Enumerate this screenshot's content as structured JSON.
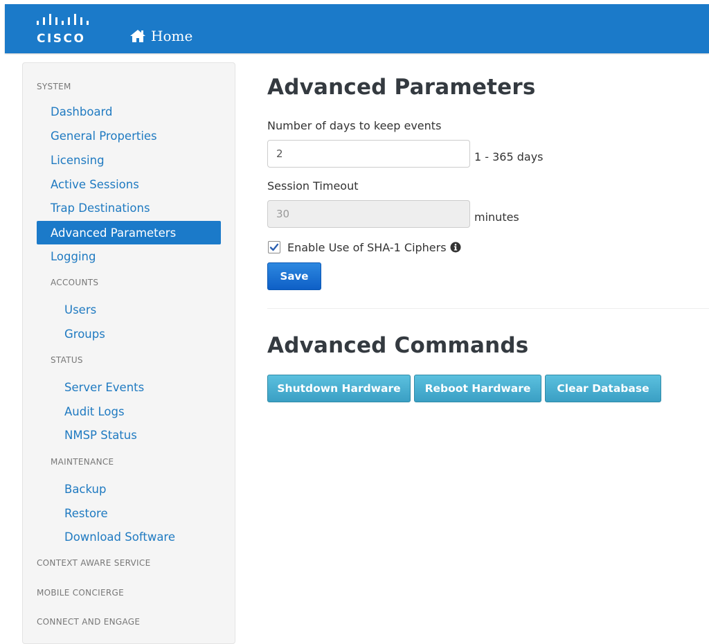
{
  "header": {
    "logo_text": "CISCO",
    "home_label": "Home",
    "colors": {
      "bar": "#1b7ac9"
    },
    "icons": {
      "logo": "cisco-bars-icon",
      "home": "home-icon"
    }
  },
  "sidebar": {
    "system_heading": "SYSTEM",
    "items": [
      {
        "label": "Dashboard"
      },
      {
        "label": "General Properties"
      },
      {
        "label": "Licensing"
      },
      {
        "label": "Active Sessions"
      },
      {
        "label": "Trap Destinations"
      },
      {
        "label": "Advanced Parameters",
        "active": true
      },
      {
        "label": "Logging"
      }
    ],
    "accounts": {
      "heading": "ACCOUNTS",
      "items": [
        {
          "label": "Users"
        },
        {
          "label": "Groups"
        }
      ]
    },
    "status": {
      "heading": "STATUS",
      "items": [
        {
          "label": "Server Events"
        },
        {
          "label": "Audit Logs"
        },
        {
          "label": "NMSP Status"
        }
      ]
    },
    "maintenance": {
      "heading": "MAINTENANCE",
      "items": [
        {
          "label": "Backup"
        },
        {
          "label": "Restore"
        },
        {
          "label": "Download Software"
        }
      ]
    },
    "sections": [
      {
        "label": "CONTEXT AWARE SERVICE"
      },
      {
        "label": "MOBILE CONCIERGE"
      },
      {
        "label": "CONNECT AND ENGAGE"
      }
    ]
  },
  "advanced_parameters": {
    "title": "Advanced Parameters",
    "days_label": "Number of days to keep events",
    "days_value": "2",
    "days_suffix": "1 - 365 days",
    "timeout_label": "Session Timeout",
    "timeout_value": "30",
    "timeout_suffix": "minutes",
    "sha1_label": "Enable Use of SHA-1 Ciphers",
    "sha1_checked": true,
    "save_label": "Save"
  },
  "advanced_commands": {
    "title": "Advanced Commands",
    "buttons": [
      {
        "label": "Shutdown Hardware"
      },
      {
        "label": "Reboot Hardware"
      },
      {
        "label": "Clear Database"
      }
    ]
  }
}
